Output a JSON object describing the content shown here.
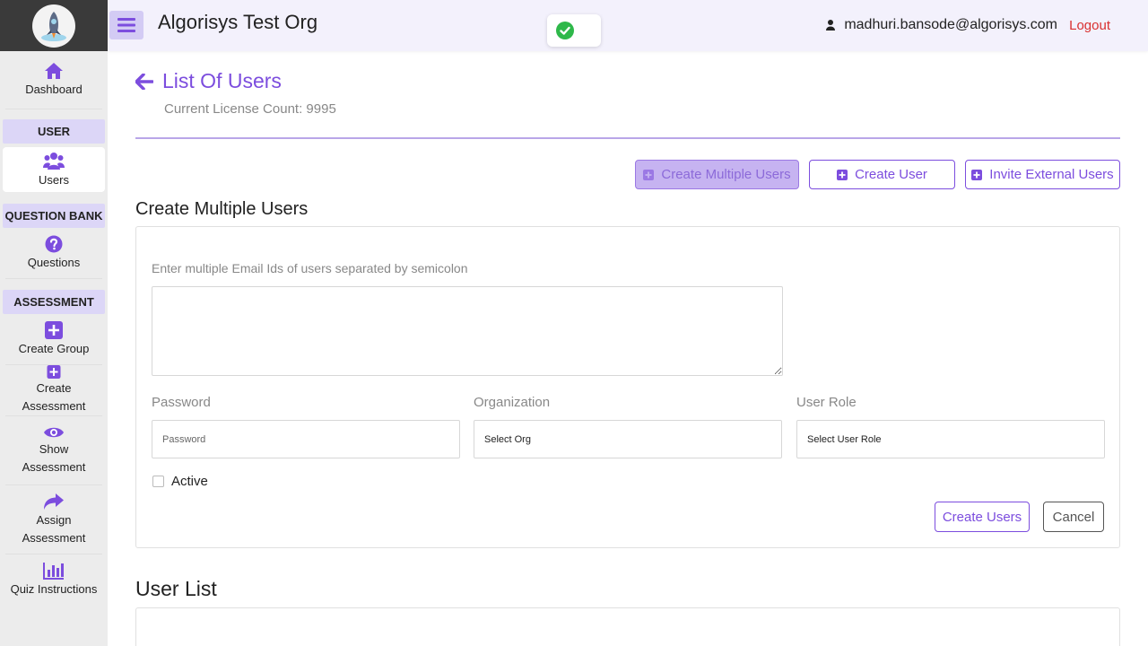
{
  "sidebar": {
    "logo_icon": "rocket-logo-icon",
    "items": {
      "dashboard": {
        "label": "Dashboard",
        "icon": "home-icon"
      },
      "users": {
        "label": "Users",
        "icon": "users-icon"
      },
      "questions": {
        "label": "Questions",
        "icon": "question-circle-icon"
      },
      "create_group": {
        "label": "Create Group",
        "icon": "plus-square-icon"
      },
      "create_assessment": {
        "label": "Create Assessment",
        "icon": "plus-square-icon"
      },
      "show_assessment": {
        "label": "Show Assessment",
        "icon": "eye-icon"
      },
      "assign_assessment": {
        "label": "Assign Assessment",
        "icon": "share-icon"
      },
      "quiz_instructions": {
        "label": "Quiz Instructions",
        "icon": "bar-chart-icon"
      }
    },
    "sections": {
      "user": "USER",
      "question_bank": "QUESTION BANK",
      "assessment": "ASSESSMENT"
    }
  },
  "header": {
    "org_title": "Algorisys Test Org",
    "user_email": "madhuri.bansode@algorisys.com",
    "logout": "Logout"
  },
  "page": {
    "title": "List Of Users",
    "license": "Current License Count: 9995"
  },
  "actions": {
    "create_multiple": "Create Multiple Users",
    "create_user": "Create User",
    "invite_external": "Invite External Users"
  },
  "form": {
    "section_title": "Create Multiple Users",
    "email_label": "Enter multiple Email Ids of users separated by semicolon",
    "email_value": "",
    "password_label": "Password",
    "password_placeholder": "Password",
    "organization_label": "Organization",
    "organization_value": "Select Org",
    "role_label": "User Role",
    "role_value": "Select User Role",
    "active_label": "Active",
    "active_checked": false,
    "submit": "Create Users",
    "cancel": "Cancel"
  },
  "user_list": {
    "title": "User List"
  },
  "colors": {
    "accent": "#7c4dde",
    "section_bg": "#dcd6f7",
    "header_bg": "#f3f1fc",
    "logout": "#d9302f",
    "success": "#2eb84a"
  }
}
